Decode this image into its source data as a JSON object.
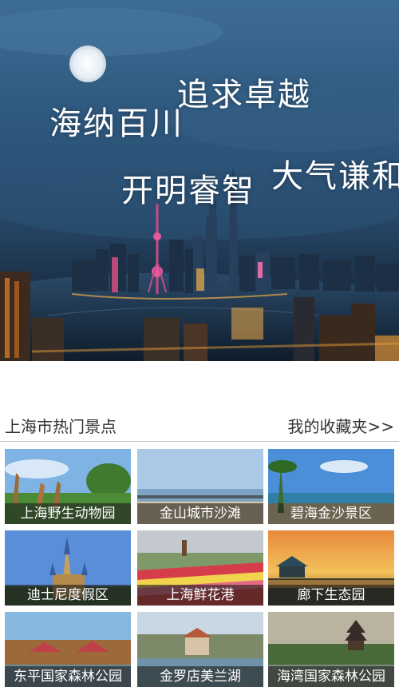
{
  "banner": {
    "slogans": [
      "海纳百川",
      "追求卓越",
      "开明睿智",
      "大气谦和"
    ]
  },
  "section": {
    "title": "上海市热门景点",
    "favorites_link": "我的收藏夹>>"
  },
  "attractions": [
    {
      "name": "上海野生动物园"
    },
    {
      "name": "金山城市沙滩"
    },
    {
      "name": "碧海金沙景区"
    },
    {
      "name": "迪士尼度假区"
    },
    {
      "name": "上海鲜花港"
    },
    {
      "name": "廊下生态园"
    },
    {
      "name": "东平国家森林公园"
    },
    {
      "name": "金罗店美兰湖"
    },
    {
      "name": "海湾国家森林公园"
    }
  ]
}
